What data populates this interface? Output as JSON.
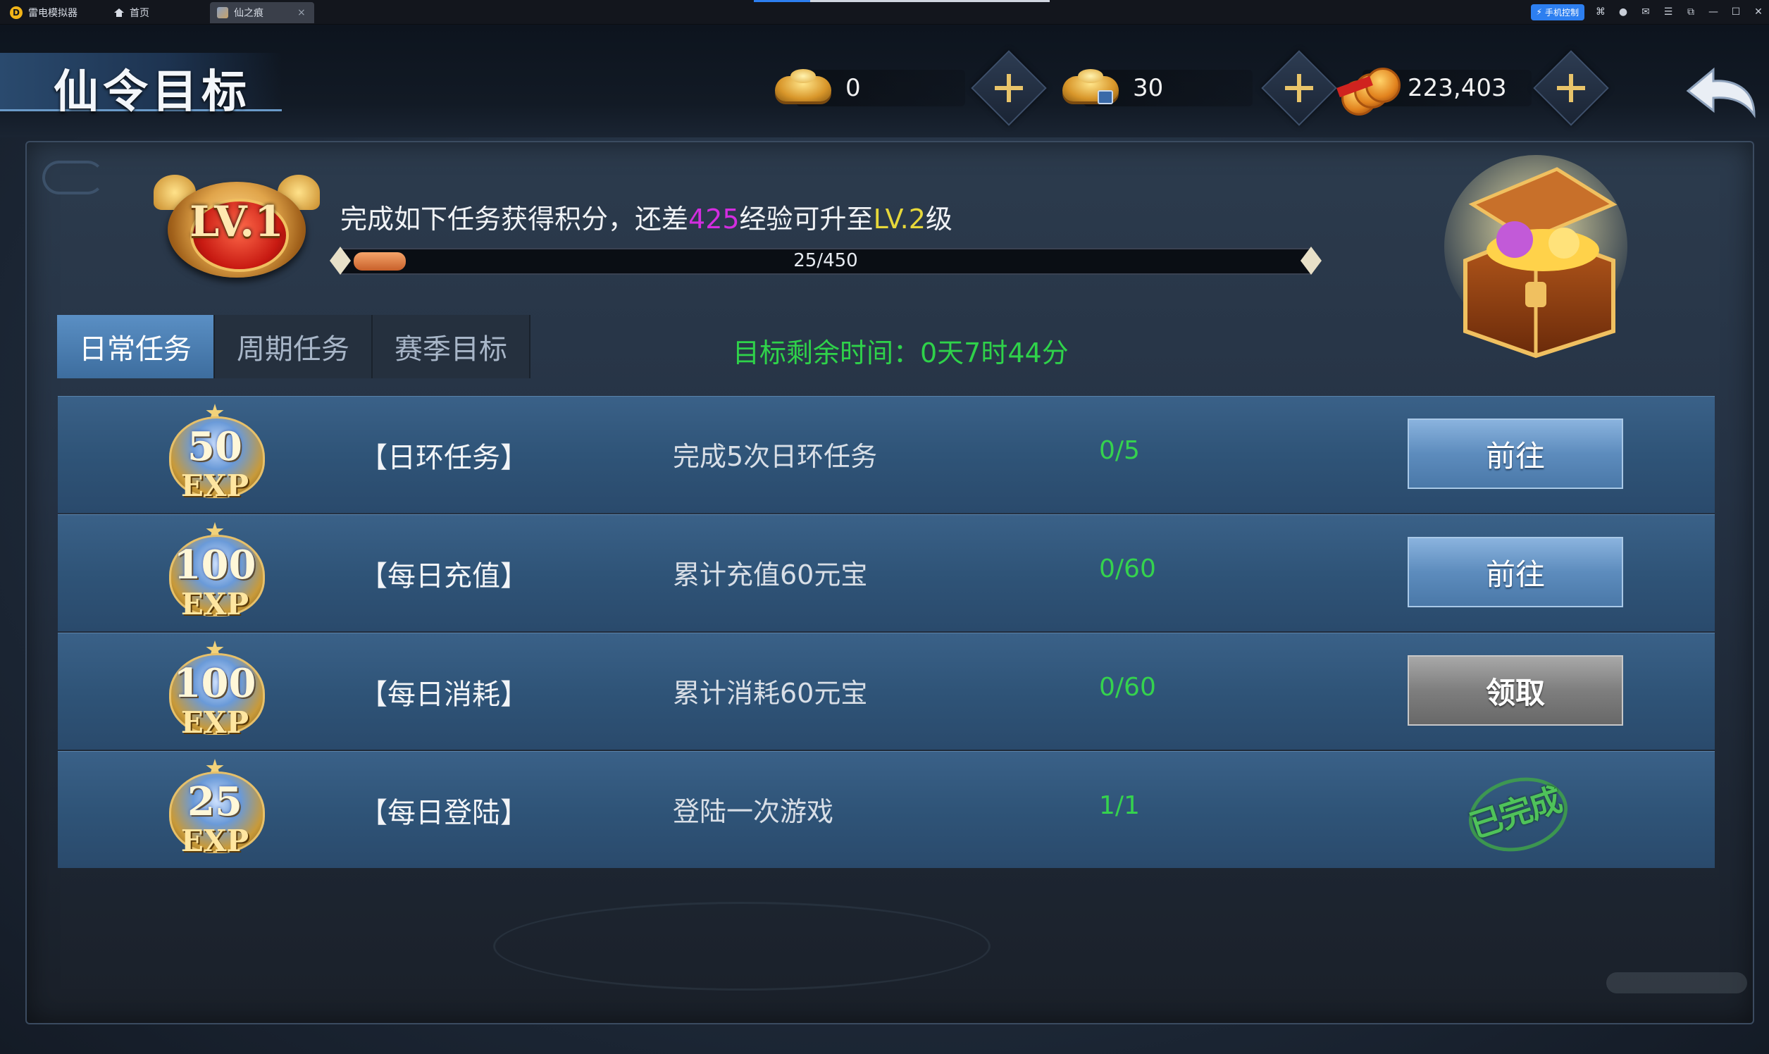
{
  "emulator": {
    "logo_glyph": "D",
    "app_name": "雷电模拟器",
    "tabs": [
      {
        "label": "首页",
        "icon": "home-icon"
      },
      {
        "label": "仙之痕",
        "icon": "game-icon",
        "close": "×"
      }
    ],
    "phone_control_label": "手机控制",
    "window_icons": [
      "gamepad-icon",
      "user-icon",
      "mail-icon",
      "menu-icon",
      "restore-icon",
      "minimize-icon",
      "maximize-icon",
      "close-icon"
    ],
    "window_glyphs": [
      "⌘",
      "●",
      "✉",
      "☰",
      "⧉",
      "—",
      "☐",
      "✕"
    ]
  },
  "header": {
    "title": "仙令目标",
    "currencies": [
      {
        "name": "gold-ingot",
        "value": "0"
      },
      {
        "name": "bound-ingot",
        "value": "30"
      },
      {
        "name": "copper-coin",
        "value": "223,403"
      }
    ]
  },
  "level": {
    "badge": "LV.1",
    "desc_prefix": "完成如下任务获得积分，还差",
    "desc_needed": "425",
    "desc_mid": "经验可升至",
    "desc_next": "LV.2",
    "desc_suffix": "级",
    "progress_label": "25/450",
    "progress_current": 25,
    "progress_max": 450
  },
  "tabs": [
    {
      "label": "日常任务",
      "active": true
    },
    {
      "label": "周期任务",
      "active": false
    },
    {
      "label": "赛季目标",
      "active": false
    }
  ],
  "timer": "目标剩余时间：0天7时44分",
  "tasks": [
    {
      "exp": "50",
      "exp_label": "EXP",
      "name": "【日环任务】",
      "desc": "完成5次日环任务",
      "progress": "0/5",
      "action": "前往",
      "state": "go"
    },
    {
      "exp": "100",
      "exp_label": "EXP",
      "name": "【每日充值】",
      "desc": "累计充值60元宝",
      "progress": "0/60",
      "action": "前往",
      "state": "go"
    },
    {
      "exp": "100",
      "exp_label": "EXP",
      "name": "【每日消耗】",
      "desc": "累计消耗60元宝",
      "progress": "0/60",
      "action": "领取",
      "state": "claim"
    },
    {
      "exp": "25",
      "exp_label": "EXP",
      "name": "【每日登陆】",
      "desc": "登陆一次游戏",
      "progress": "1/1",
      "action": "已完成",
      "state": "done"
    }
  ],
  "colors": {
    "progress_green": "#35d24e",
    "highlight_purple": "#d32de0",
    "highlight_yellow": "#e6d73a",
    "tab_active": "#4a7db0"
  }
}
